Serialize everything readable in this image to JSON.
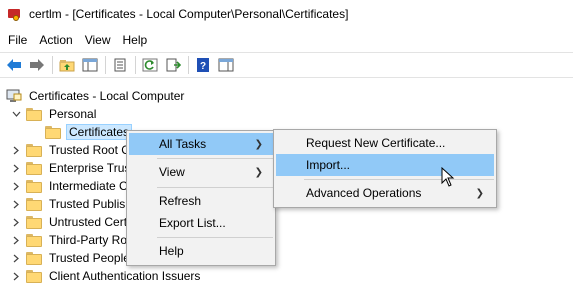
{
  "window": {
    "title": "certlm - [Certificates - Local Computer\\Personal\\Certificates]"
  },
  "menubar": {
    "items": [
      "File",
      "Action",
      "View",
      "Help"
    ]
  },
  "toolbar": {
    "buttons": [
      "back-arrow-icon",
      "forward-arrow-icon",
      "up-folder-icon",
      "show-hide-tree-icon",
      "properties-icon",
      "refresh-icon",
      "export-list-icon",
      "help-icon",
      "action-pane-icon"
    ]
  },
  "tree": {
    "root": "Certificates - Local Computer",
    "personal": "Personal",
    "certificates": "Certificates",
    "stores": [
      "Trusted Root C",
      "Enterprise Trus",
      "Intermediate C",
      "Trusted Publish",
      "Untrusted Cert",
      "Third-Party Ro",
      "Trusted People",
      "Client Authentication Issuers"
    ]
  },
  "context_menu": {
    "all_tasks": "All Tasks",
    "view": "View",
    "refresh": "Refresh",
    "export_list": "Export List...",
    "help": "Help"
  },
  "submenu": {
    "request_new": "Request New Certificate...",
    "import": "Import...",
    "advanced": "Advanced Operations"
  },
  "colors": {
    "highlight": "#91c9f7",
    "menu_bg": "#f2f2f2",
    "selection": "#cce8ff",
    "folder": "#ffd874"
  }
}
